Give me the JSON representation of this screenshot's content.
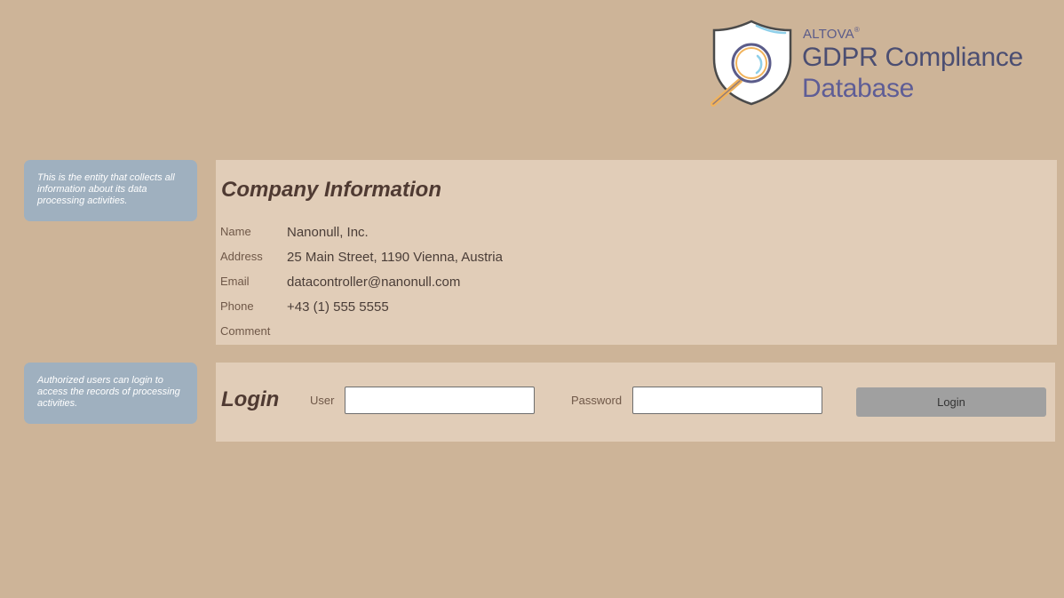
{
  "logo": {
    "brand": "ALTOVA",
    "brand_mark": "®",
    "line1": "GDPR Compliance",
    "line2": "Database",
    "icon": "shield-magnifier-icon",
    "colors": {
      "navy": "#4b4e72",
      "purple": "#5e5d96",
      "accent_blue": "#8fd0ea",
      "handle": "#f1b35c"
    }
  },
  "notes": {
    "company": "This is the entity that collects all information about its data processing activities.",
    "login": "Authorized users can login to access the records of processing activities."
  },
  "company": {
    "title": "Company Information",
    "fields": [
      {
        "label": "Name",
        "value": "Nanonull, Inc."
      },
      {
        "label": "Address",
        "value": "25 Main Street, 1190 Vienna, Austria"
      },
      {
        "label": "Email",
        "value": "datacontroller@nanonull.com"
      },
      {
        "label": "Phone",
        "value": "+43 (1) 555 5555"
      },
      {
        "label": "Comment",
        "value": ""
      }
    ]
  },
  "login": {
    "title": "Login",
    "user_label": "User",
    "user_value": "",
    "password_label": "Password",
    "password_value": "",
    "button_label": "Login"
  },
  "colors": {
    "background": "#cdb498",
    "panel": "#e1cdb8",
    "note": "#9fb0bf",
    "button": "#a0a0a0"
  }
}
